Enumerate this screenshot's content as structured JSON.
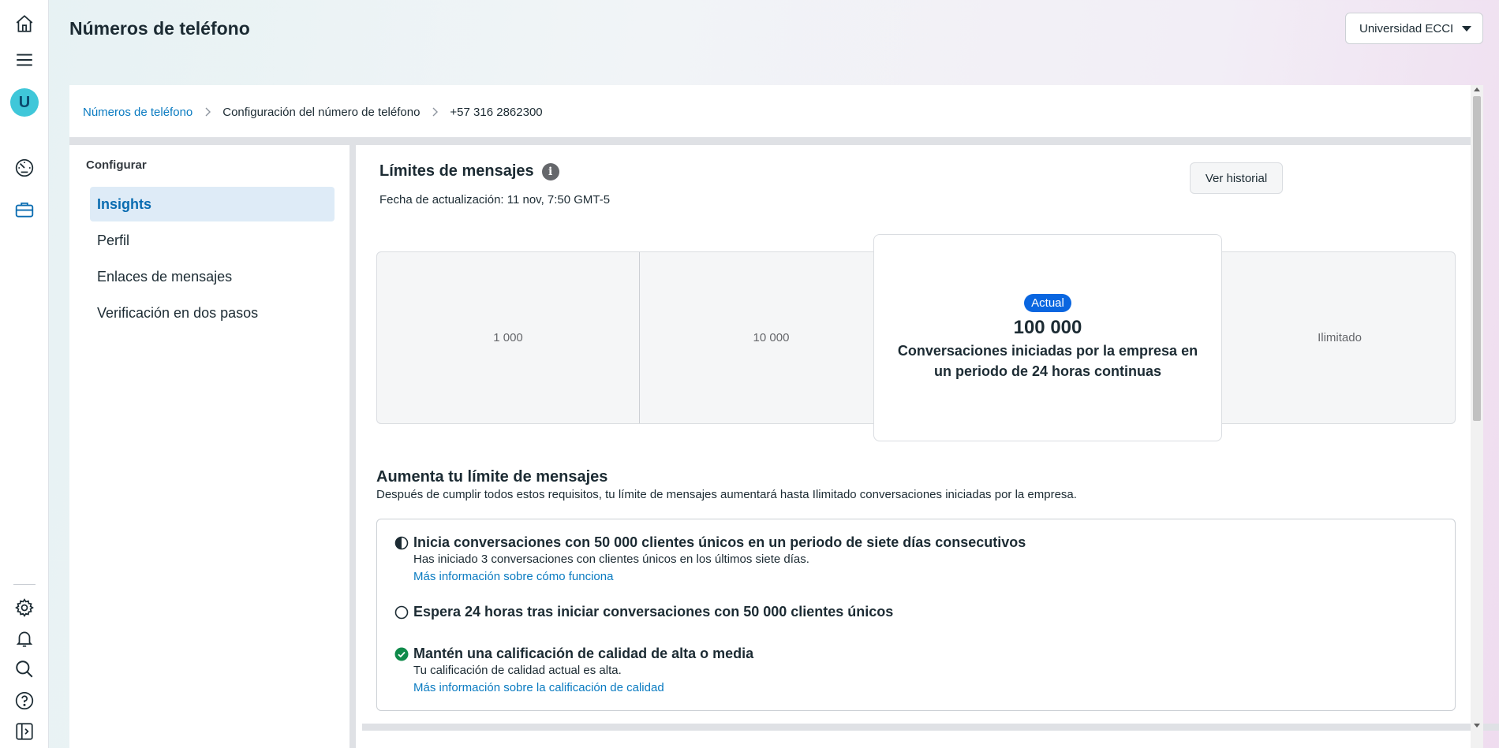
{
  "header": {
    "title": "Números de teléfono",
    "account_selector": "Universidad ECCI"
  },
  "rail": {
    "avatar_letter": "U",
    "icons": [
      "home-icon",
      "menu-icon",
      "speedometer-icon",
      "briefcase-icon",
      "gear-icon",
      "bell-icon",
      "search-icon",
      "help-icon",
      "panel-toggle-icon"
    ]
  },
  "breadcrumb": {
    "items": [
      "Números de teléfono",
      "Configuración del número de teléfono",
      "+57 316 2862300"
    ]
  },
  "sidebar": {
    "heading": "Configurar",
    "items": [
      {
        "label": "Insights",
        "active": true
      },
      {
        "label": "Perfil",
        "active": false
      },
      {
        "label": "Enlaces de mensajes",
        "active": false
      },
      {
        "label": "Verificación en dos pasos",
        "active": false
      }
    ]
  },
  "limits": {
    "title": "Límites de mensajes",
    "updated": "Fecha de actualización: 11 nov, 7:50 GMT-5",
    "history_button": "Ver historial",
    "tiers": [
      "1 000",
      "10 000",
      "Ilimitado"
    ],
    "current": {
      "badge": "Actual",
      "value": "100 000",
      "description": "Conversaciones iniciadas por la empresa en un periodo de 24 horas continuas"
    }
  },
  "increase": {
    "title": "Aumenta tu límite de mensajes",
    "description": "Después de cumplir todos estos requisitos, tu límite de mensajes aumentará hasta Ilimitado conversaciones iniciadas por la empresa.",
    "requirements": [
      {
        "status": "in-progress",
        "title": "Inicia conversaciones con 50 000 clientes únicos en un periodo de siete días consecutivos",
        "text": "Has iniciado 3 conversaciones con clientes únicos en los últimos siete días.",
        "link": "Más información sobre cómo funciona"
      },
      {
        "status": "pending",
        "title": "Espera 24 horas tras iniciar conversaciones con 50 000 clientes únicos"
      },
      {
        "status": "complete",
        "title": "Mantén una calificación de calidad de alta o media",
        "text": "Tu calificación de calidad actual es alta.",
        "link": "Más información sobre la calificación de calidad"
      }
    ]
  },
  "colors": {
    "accent": "#0a66e0",
    "link": "#0a7bc1",
    "success": "#0f8a4a",
    "avatar": "#3fc7d9"
  }
}
